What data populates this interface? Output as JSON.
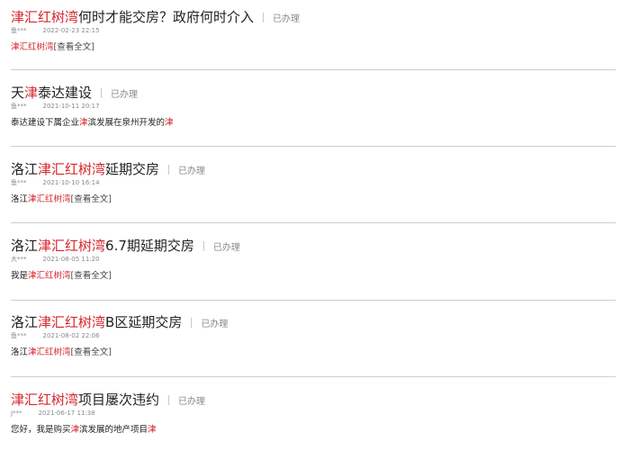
{
  "items": [
    {
      "title": [
        {
          "t": "津汇红树湾",
          "h": true
        },
        {
          "t": "何时才能交房？政府何时介入",
          "h": false
        }
      ],
      "status": "已办理",
      "user": "鱼***",
      "time": "2022-02-23 22:15",
      "summary": [
        {
          "t": "津汇红树湾",
          "h": true
        }
      ],
      "more": "[查看全文]"
    },
    {
      "title": [
        {
          "t": "天",
          "h": false
        },
        {
          "t": "津",
          "h": true
        },
        {
          "t": "泰达建设",
          "h": false
        }
      ],
      "status": "已办理",
      "user": "鱼***",
      "time": "2021-10-11 20:17",
      "summary": [
        {
          "t": "泰达建设下属企业",
          "h": false
        },
        {
          "t": "津",
          "h": true
        },
        {
          "t": "滨发展在泉州开发的",
          "h": false
        },
        {
          "t": "津",
          "h": true
        }
      ],
      "more": ""
    },
    {
      "title": [
        {
          "t": "洛江",
          "h": false
        },
        {
          "t": "津汇红树湾",
          "h": true
        },
        {
          "t": "延期交房",
          "h": false
        }
      ],
      "status": "已办理",
      "user": "鱼***",
      "time": "2021-10-10 16:14",
      "summary": [
        {
          "t": "洛江",
          "h": false
        },
        {
          "t": "津汇红树湾",
          "h": true
        }
      ],
      "more": "[查看全文]"
    },
    {
      "title": [
        {
          "t": "洛江",
          "h": false
        },
        {
          "t": "津汇红树湾",
          "h": true
        },
        {
          "t": "6.7期延期交房",
          "h": false
        }
      ],
      "status": "已办理",
      "user": "大***",
      "time": "2021-08-05 11:20",
      "summary": [
        {
          "t": "我是",
          "h": false
        },
        {
          "t": "津汇红树湾",
          "h": true
        }
      ],
      "more": "[查看全文]"
    },
    {
      "title": [
        {
          "t": "洛江",
          "h": false
        },
        {
          "t": "津汇红树湾",
          "h": true
        },
        {
          "t": "B区延期交房",
          "h": false
        }
      ],
      "status": "已办理",
      "user": "鱼***",
      "time": "2021-08-02 22:06",
      "summary": [
        {
          "t": "洛江",
          "h": false
        },
        {
          "t": "津汇红树湾",
          "h": true
        }
      ],
      "more": "[查看全文]"
    },
    {
      "title": [
        {
          "t": "津汇红树湾",
          "h": true
        },
        {
          "t": "项目屡次违约",
          "h": false
        }
      ],
      "status": "已办理",
      "user": "J***",
      "time": "2021-06-17 11:38",
      "summary": [
        {
          "t": "您好，我是购买",
          "h": false
        },
        {
          "t": "津",
          "h": true
        },
        {
          "t": "滨发展的地产项目",
          "h": false
        },
        {
          "t": "津",
          "h": true
        }
      ],
      "more": ""
    }
  ]
}
